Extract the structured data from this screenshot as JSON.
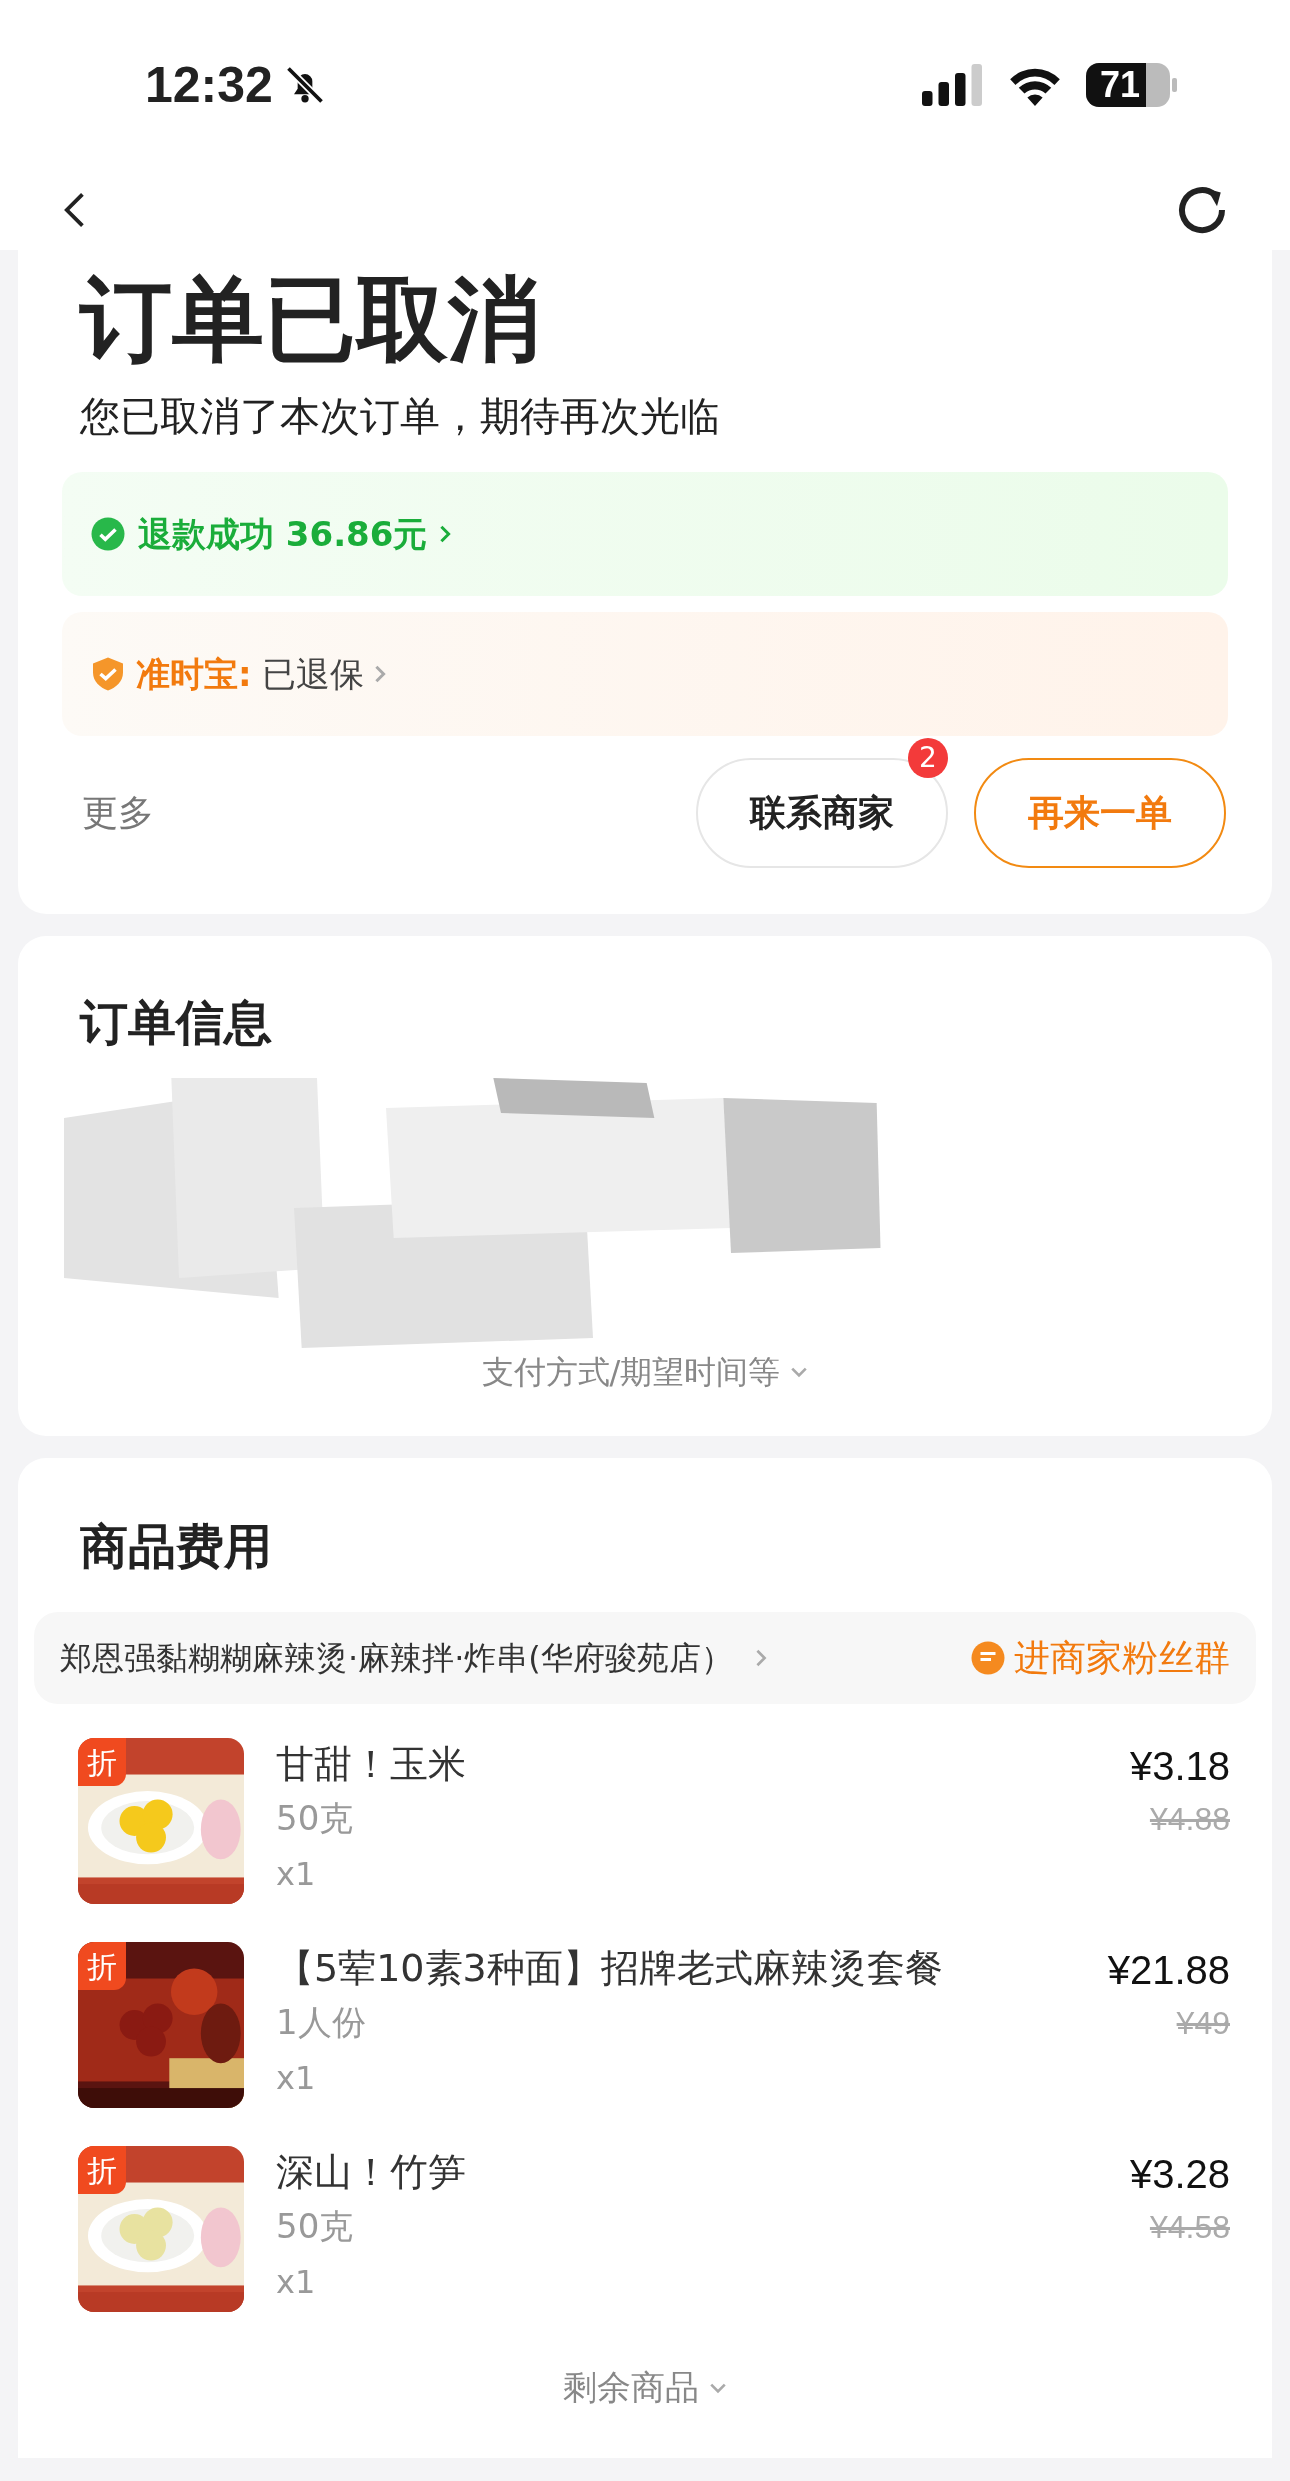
{
  "status_bar": {
    "time": "12:32",
    "battery": "71"
  },
  "header": {
    "title": "订单已取消",
    "subtitle": "您已取消了本次订单，期待再次光临"
  },
  "notices": [
    {
      "kind": "refund",
      "label": "退款成功 36.86元"
    },
    {
      "kind": "insurance",
      "label": "准时宝:",
      "value": "已退保"
    }
  ],
  "actions": {
    "more": "更多",
    "contact": {
      "label": "联系商家",
      "badge": "2"
    },
    "reorder": "再来一单"
  },
  "order_info": {
    "title": "订单信息",
    "expand": "支付方式/期望时间等"
  },
  "goods": {
    "title": "商品费用",
    "shop": "郑恩强黏糊糊麻辣烫·麻辣拌·炸串(华府骏苑店）",
    "fan_group": "进商家粉丝群",
    "items": [
      {
        "tag": "折",
        "name": "甘甜！玉米",
        "spec": "50克",
        "qty": "x1",
        "price": "¥3.18",
        "original_price": "¥4.88",
        "kind": "corn"
      },
      {
        "tag": "折",
        "name": "【5荤10素3种面】招牌老式麻辣烫套餐",
        "spec": "1人份",
        "qty": "x1",
        "price": "¥21.88",
        "original_price": "¥49",
        "kind": "spicy"
      },
      {
        "tag": "折",
        "name": "深山！竹笋",
        "spec": "50克",
        "qty": "x1",
        "price": "¥3.28",
        "original_price": "¥4.58",
        "kind": "bamboo"
      }
    ],
    "more_items": "剩余商品"
  }
}
